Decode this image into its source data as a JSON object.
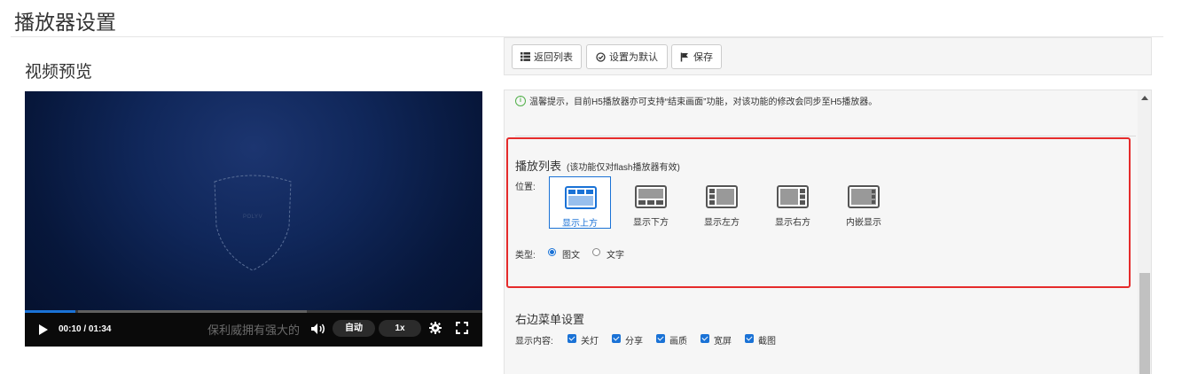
{
  "page": {
    "title": "播放器设置"
  },
  "preview": {
    "title": "视频预览"
  },
  "player": {
    "logo_text": "POLYV",
    "time": "00:10 / 01:34",
    "progress": 0.11,
    "marquee": "保利威拥有强大的",
    "quality": "自动",
    "speed": "1x"
  },
  "toolbar": {
    "back_label": "返回列表",
    "default_label": "设置为默认",
    "save_label": "保存"
  },
  "tip": {
    "text": "温馨提示，目前H5播放器亦可支持“结束画面”功能，对该功能的修改会同步至H5播放器。"
  },
  "playlist": {
    "title": "播放列表",
    "note": "(该功能仅对flash播放器有效)",
    "position_label": "位置:",
    "positions": [
      {
        "label": "显示上方",
        "icon": "layout-top-icon",
        "selected": true
      },
      {
        "label": "显示下方",
        "icon": "layout-bottom-icon",
        "selected": false
      },
      {
        "label": "显示左方",
        "icon": "layout-left-icon",
        "selected": false
      },
      {
        "label": "显示右方",
        "icon": "layout-right-icon",
        "selected": false
      },
      {
        "label": "内嵌显示",
        "icon": "layout-embed-icon",
        "selected": false
      }
    ],
    "type_label": "类型:",
    "types": [
      {
        "label": "图文",
        "selected": true
      },
      {
        "label": "文字",
        "selected": false
      }
    ]
  },
  "right_menu": {
    "title": "右边菜单设置",
    "content_label": "显示内容:",
    "items": [
      {
        "label": "关灯",
        "checked": true
      },
      {
        "label": "分享",
        "checked": true
      },
      {
        "label": "画质",
        "checked": true
      },
      {
        "label": "宽屏",
        "checked": true
      },
      {
        "label": "截图",
        "checked": true
      }
    ]
  },
  "colors": {
    "accent": "#1a72d6",
    "highlight": "#e52b2b",
    "tip_icon": "#52b04a"
  }
}
